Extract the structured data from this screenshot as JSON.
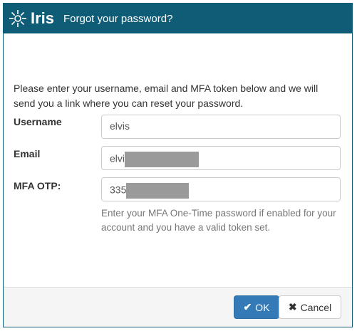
{
  "app": {
    "logo_text": "Iris"
  },
  "dialog": {
    "title": "Forgot your password?",
    "message": "Please enter your username, email and MFA token below and we will send you a link where you can reset your password."
  },
  "form": {
    "username": {
      "label": "Username",
      "value": "elvis"
    },
    "email": {
      "label": "Email",
      "value_visible": "elvi"
    },
    "mfa": {
      "label": "MFA OTP:",
      "value_visible": "335",
      "help": "Enter your MFA One-Time password if enabled for your account and you have a valid token set."
    }
  },
  "buttons": {
    "ok": {
      "label": "OK",
      "icon": "check-icon"
    },
    "cancel": {
      "label": "Cancel",
      "icon": "close-icon"
    }
  },
  "colors": {
    "titlebar": "#0f5c76",
    "primary": "#337ab7"
  }
}
